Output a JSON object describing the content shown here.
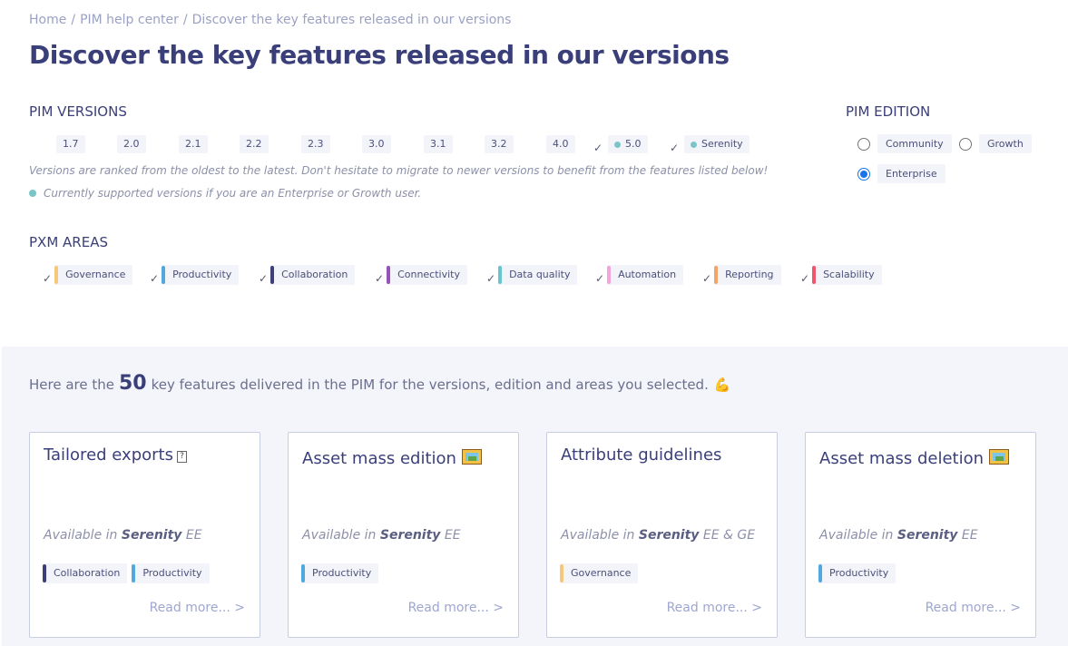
{
  "breadcrumb": {
    "home": "Home",
    "sep": "/",
    "help": "PIM help center",
    "current": "Discover the key features released in our versions"
  },
  "page_title": "Discover the key features released in our versions",
  "pim_versions": {
    "title": "PIM VERSIONS",
    "items": [
      {
        "label": "1.7",
        "checked": false,
        "supported": false
      },
      {
        "label": "2.0",
        "checked": false,
        "supported": false
      },
      {
        "label": "2.1",
        "checked": false,
        "supported": false
      },
      {
        "label": "2.2",
        "checked": false,
        "supported": false
      },
      {
        "label": "2.3",
        "checked": false,
        "supported": false
      },
      {
        "label": "3.0",
        "checked": false,
        "supported": false
      },
      {
        "label": "3.1",
        "checked": false,
        "supported": false
      },
      {
        "label": "3.2",
        "checked": false,
        "supported": false
      },
      {
        "label": "4.0",
        "checked": false,
        "supported": false
      },
      {
        "label": "5.0",
        "checked": true,
        "supported": true
      },
      {
        "label": "Serenity",
        "checked": true,
        "supported": true
      }
    ],
    "note": "Versions are ranked from the oldest to the latest. Don't hesitate to migrate to newer versions to benefit from the features listed below!",
    "supported_note": "Currently supported versions if you are an Enterprise or Growth user."
  },
  "pim_edition": {
    "title": "PIM EDITION",
    "options": [
      {
        "label": "Community",
        "selected": false
      },
      {
        "label": "Growth",
        "selected": false
      },
      {
        "label": "Enterprise",
        "selected": true
      }
    ]
  },
  "pxm_areas": {
    "title": "PXM AREAS",
    "items": [
      {
        "label": "Governance",
        "color": "#f6c97a"
      },
      {
        "label": "Productivity",
        "color": "#4fa8de"
      },
      {
        "label": "Collaboration",
        "color": "#3c3f7a"
      },
      {
        "label": "Connectivity",
        "color": "#9452ba"
      },
      {
        "label": "Data quality",
        "color": "#67c6cc"
      },
      {
        "label": "Automation",
        "color": "#f2a4dc"
      },
      {
        "label": "Reporting",
        "color": "#f5a468"
      },
      {
        "label": "Scalability",
        "color": "#f0566b"
      }
    ]
  },
  "results": {
    "prefix": "Here are the",
    "count": "50",
    "suffix": "key features delivered in the PIM for the versions, edition and areas you selected.",
    "emoji": "💪"
  },
  "cards": [
    {
      "title": "Tailored exports",
      "icon": "question-box-icon",
      "avail_prefix": "Available in",
      "version": "Serenity",
      "editions": "EE",
      "tags": [
        {
          "label": "Collaboration",
          "color": "#3c3f7a"
        },
        {
          "label": "Productivity",
          "color": "#4fa8de"
        }
      ],
      "read_more": "Read more... >"
    },
    {
      "title": "Asset mass edition",
      "icon": "framed-picture-icon",
      "avail_prefix": "Available in",
      "version": "Serenity",
      "editions": "EE",
      "tags": [
        {
          "label": "Productivity",
          "color": "#4fa8de"
        }
      ],
      "read_more": "Read more... >"
    },
    {
      "title": "Attribute guidelines",
      "icon": "",
      "avail_prefix": "Available in",
      "version": "Serenity",
      "editions": "EE & GE",
      "tags": [
        {
          "label": "Governance",
          "color": "#f6c97a"
        }
      ],
      "read_more": "Read more... >"
    },
    {
      "title": "Asset mass deletion",
      "icon": "framed-picture-icon",
      "avail_prefix": "Available in",
      "version": "Serenity",
      "editions": "EE",
      "tags": [
        {
          "label": "Productivity",
          "color": "#4fa8de"
        }
      ],
      "read_more": "Read more... >"
    }
  ]
}
